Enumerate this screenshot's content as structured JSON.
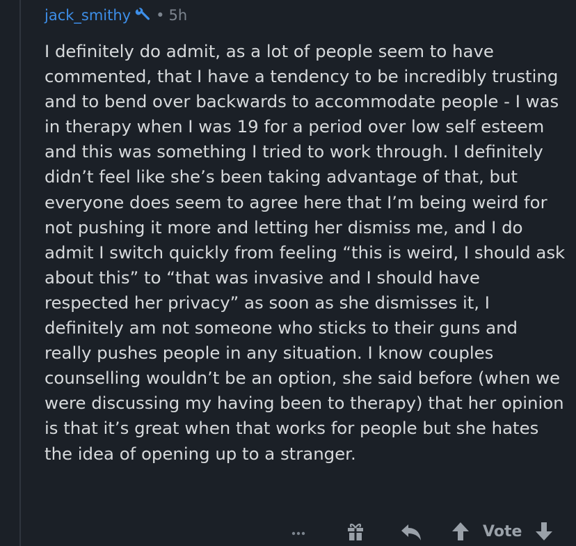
{
  "comment": {
    "username": "jack_smithy",
    "separator": "•",
    "timestamp": "5h",
    "mod_icon": "wrench-icon",
    "body": "I definitely do admit, as a lot of people seem to have commented, that I have a tendency to be incredibly trusting and to bend over backwards to accommodate people - I was in therapy when I was 19 for a period over low self esteem and this was something I tried to work through. I definitely didn’t feel like she’s been taking advantage of that, but everyone does seem to agree here that I’m being weird for not pushing it more and letting her dismiss me, and I do admit I switch quickly from feeling “this is weird, I should ask about this” to “that was invasive and I should have respected her privacy” as soon as she dismisses it, I definitely am not someone who sticks to their guns and really pushes people in any situation. I know couples counselling wouldn’t be an option, she said before (when we were discussing my having been to therapy) that her opinion is that it’s great when that works for people but she hates the idea of opening up to a stranger."
  },
  "actions": {
    "more_icon": "more-options-icon",
    "award_icon": "gift-award-icon",
    "reply_icon": "reply-arrow-icon",
    "upvote_icon": "upvote-arrow-icon",
    "vote_label": "Vote",
    "downvote_icon": "downvote-arrow-icon"
  },
  "colors": {
    "background": "#1b2027",
    "username": "#3d8ee8",
    "text": "#d7dadc",
    "muted": "#7c848e",
    "icon": "#9aa1a9"
  }
}
